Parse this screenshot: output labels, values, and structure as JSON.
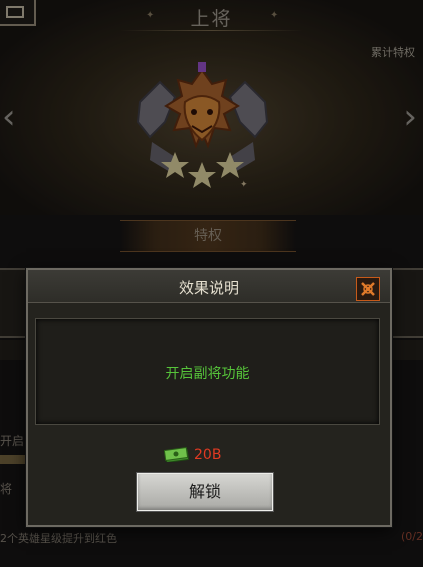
{
  "header": {
    "rank_title": "上将",
    "perks_link": "累计特权"
  },
  "background": {
    "privilege_tab": "特权",
    "row_text_1": "开启",
    "row_text_2": "将",
    "row_text_3": "2个英雄星级提升到红色",
    "progress_text": "(0/2"
  },
  "dialog": {
    "title": "效果说明",
    "description": "开启副将功能",
    "cost_value": "20B",
    "unlock_label": "解锁"
  },
  "colors": {
    "description_green": "#56c43a",
    "cost_red": "#e03a22",
    "close_orange": "#c65a1a"
  },
  "icons": [
    "back-icon",
    "prev-arrow-icon",
    "next-arrow-icon",
    "rank-emblem-icon",
    "close-icon",
    "cash-icon"
  ]
}
